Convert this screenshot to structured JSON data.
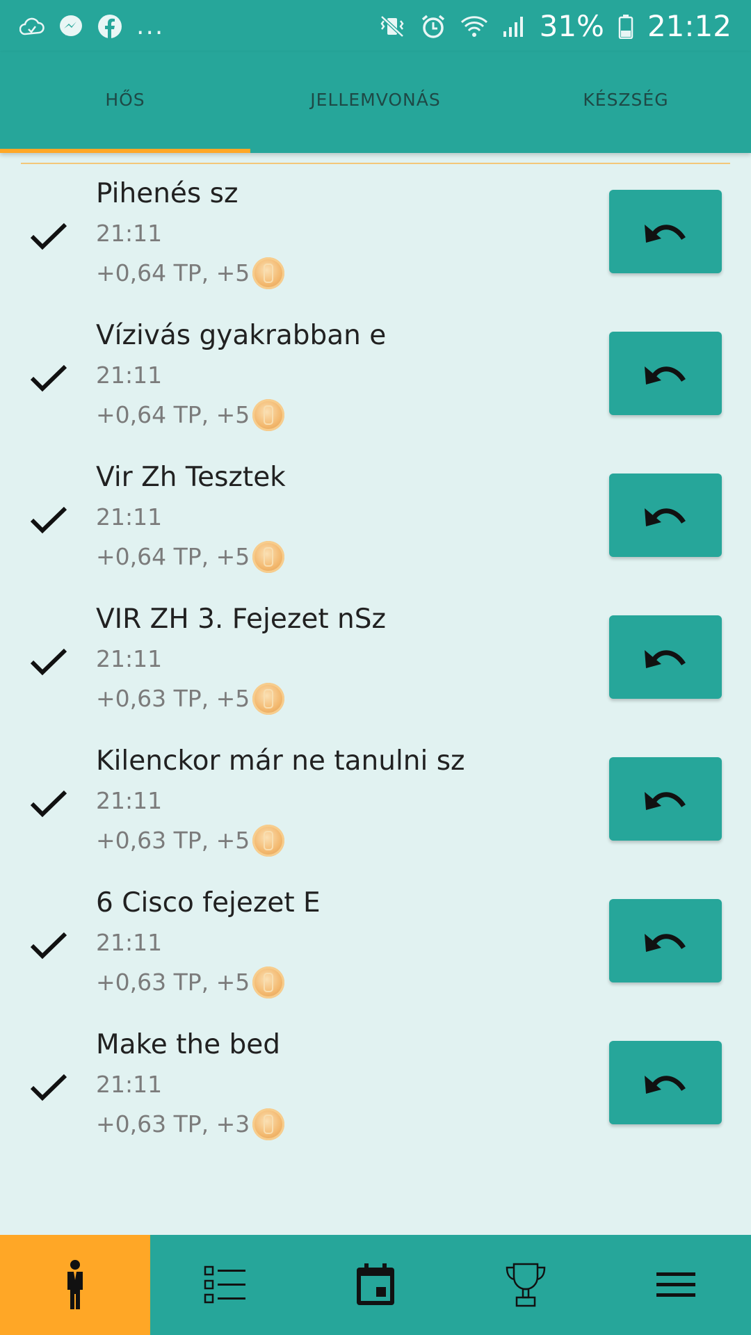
{
  "status_bar": {
    "battery": "31%",
    "time": "21:12",
    "more": "..."
  },
  "tabs": [
    {
      "label": "HŐS",
      "active": true
    },
    {
      "label": "JELLEMVONÁS",
      "active": false
    },
    {
      "label": "KÉSZSÉG",
      "active": false
    }
  ],
  "items": [
    {
      "title": "Pihenés sz",
      "time": "21:11",
      "reward": "+0,64 TP, +5"
    },
    {
      "title": "Vízivás gyakrabban e",
      "time": "21:11",
      "reward": "+0,64 TP, +5"
    },
    {
      "title": "Vir Zh Tesztek",
      "time": "21:11",
      "reward": "+0,64 TP, +5"
    },
    {
      "title": "VIR ZH 3. Fejezet nSz",
      "time": "21:11",
      "reward": "+0,63 TP, +5"
    },
    {
      "title": "Kilenckor már ne tanulni  sz",
      "time": "21:11",
      "reward": "+0,63 TP, +5"
    },
    {
      "title": "6 Cisco fejezet E",
      "time": "21:11",
      "reward": "+0,63 TP, +5"
    },
    {
      "title": "Make the bed",
      "time": "21:11",
      "reward": "+0,63 TP, +3"
    }
  ],
  "bottom_nav": [
    {
      "icon": "hero-icon",
      "active": true
    },
    {
      "icon": "checklist-icon",
      "active": false
    },
    {
      "icon": "calendar-icon",
      "active": false
    },
    {
      "icon": "trophy-icon",
      "active": false
    },
    {
      "icon": "menu-icon",
      "active": false
    }
  ],
  "colors": {
    "primary": "#26a69a",
    "accent": "#ffa726",
    "background": "#e1f2f1"
  }
}
